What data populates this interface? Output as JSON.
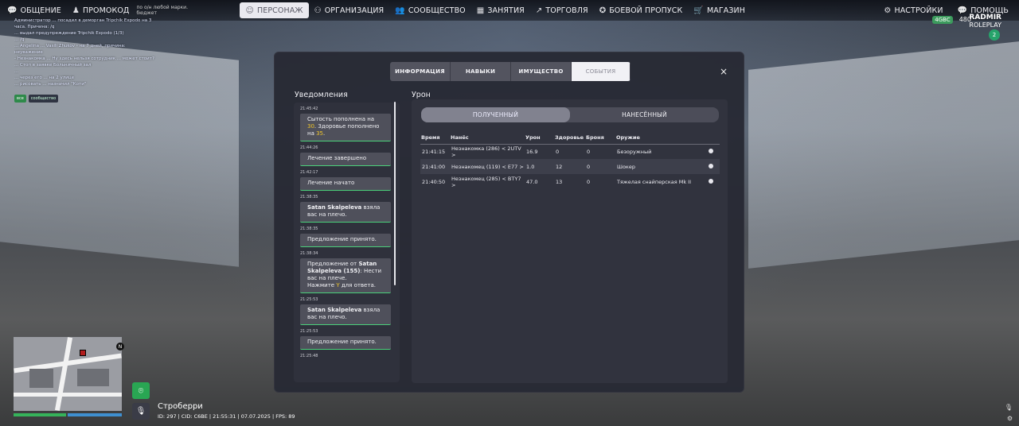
{
  "nav": {
    "items": [
      {
        "label": "ОБЩЕНИЕ",
        "icon": "chat-icon"
      },
      {
        "label": "ПРОМОКОД",
        "icon": "user-icon"
      }
    ],
    "promo_note": "по о/н любой марки. бюджет",
    "center": [
      {
        "label": "ПЕРСОНАЖ",
        "icon": "person-icon"
      },
      {
        "label": "ОРГАНИЗАЦИЯ",
        "icon": "org-icon"
      },
      {
        "label": "СООБЩЕСТВО",
        "icon": "community-icon"
      },
      {
        "label": "ЗАНЯТИЯ",
        "icon": "jobs-icon"
      },
      {
        "label": "ТОРГОВЛЯ",
        "icon": "trade-icon"
      },
      {
        "label": "БОЕВОЙ ПРОПУСК",
        "icon": "pass-icon"
      },
      {
        "label": "МАГАЗИН",
        "icon": "cart-icon"
      }
    ],
    "right": [
      {
        "label": "НАСТРОЙКИ",
        "icon": "gear-icon"
      },
      {
        "label": "ПОМОЩЬ",
        "icon": "help-icon"
      }
    ]
  },
  "hud": {
    "stat_badge": "4GBC",
    "online": "480",
    "logo_top": "RADMIR",
    "logo_bottom": "ROLEPLAY",
    "level": "2",
    "district": "Строберри",
    "info_line": "ID: 297 | CID: C6BE | 21:55:31 | 07.07.2025 | FPS: 89",
    "north": "N"
  },
  "chat": {
    "lines": [
      "Администратор ... посадил в деморган Tripchik Expodo на 3",
      "часа. Причина: /q",
      "... выдал предупреждение Tripchik Expodo (1/3)",
      "... /q",
      "... Angelina ... Vasili Zhukov - на 7 дней, причина:",
      "неуважение",
      "- Незнакомка ... Ну здесь нельзя сотрудник ... может стоит?",
      "... Стоп в заявке Больничный зал",
      "... ",
      "... через его ... на 2 улице",
      "... рисовать ... назначил \"Коти\""
    ],
    "tabs": [
      "все",
      "сообщество"
    ]
  },
  "modal": {
    "tabs": [
      "ИНФОРМАЦИЯ",
      "НАВЫКИ",
      "ИМУЩЕСТВО",
      "СОБЫТИЯ"
    ],
    "active_tab": "СОБЫТИЯ",
    "close": "×",
    "notifications_title": "Уведомления",
    "notifications": [
      {
        "time": "21:45:42",
        "parts": [
          [
            "Сытость пополнена на ",
            "30",
            ". Здоровье пополнено на ",
            "35",
            "."
          ]
        ]
      },
      {
        "time": "21:44:26",
        "text": "Лечение завершено"
      },
      {
        "time": "21:42:17",
        "text": "Лечение начато"
      },
      {
        "time": "21:38:35",
        "bold": "Satan Skalpeleva",
        "text": " взяла вас на плечо."
      },
      {
        "time": "21:38:35",
        "text": "Предложение принято."
      },
      {
        "time": "21:38:34",
        "offer": true,
        "prefix": "Предложение от ",
        "bold": "Satan Skalpeleva (155)",
        "line2": ": Нести вас на плече.",
        "line3a": "Нажмите ",
        "key": "Y",
        "line3b": " для ответа."
      },
      {
        "time": "21:25:53",
        "bold": "Satan Skalpeleva",
        "text": " взяла вас на плечо."
      },
      {
        "time": "21:25:53",
        "text": "Предложение принято."
      },
      {
        "time": "21:25:48",
        "text": ""
      }
    ],
    "damage_title": "Урон",
    "toggle": {
      "received": "ПОЛУЧЕННЫЙ",
      "dealt": "НАНЕСЁННЫЙ"
    },
    "columns": [
      "Время",
      "Нанёс",
      "Урон",
      "Здоровье",
      "Броня",
      "Оружие"
    ],
    "rows": [
      {
        "time": "21:41:15",
        "who": "Незнакомка (286) < 2UTV >",
        "dmg": "16.9",
        "hp": "0",
        "armor": "0",
        "weapon": "Безоружный"
      },
      {
        "time": "21:41:00",
        "who": "Незнакомец (119) < E77 >",
        "dmg": "1.0",
        "hp": "12",
        "armor": "0",
        "weapon": "Шокер"
      },
      {
        "time": "21:40:50",
        "who": "Незнакомец (285) < BTY7 >",
        "dmg": "47.0",
        "hp": "13",
        "armor": "0",
        "weapon": "Тяжелая снайперская Mk II"
      }
    ]
  },
  "colors": {
    "accent_green": "#4ad17a",
    "highlight": "#f0c52a",
    "gps_green": "#29a653"
  }
}
